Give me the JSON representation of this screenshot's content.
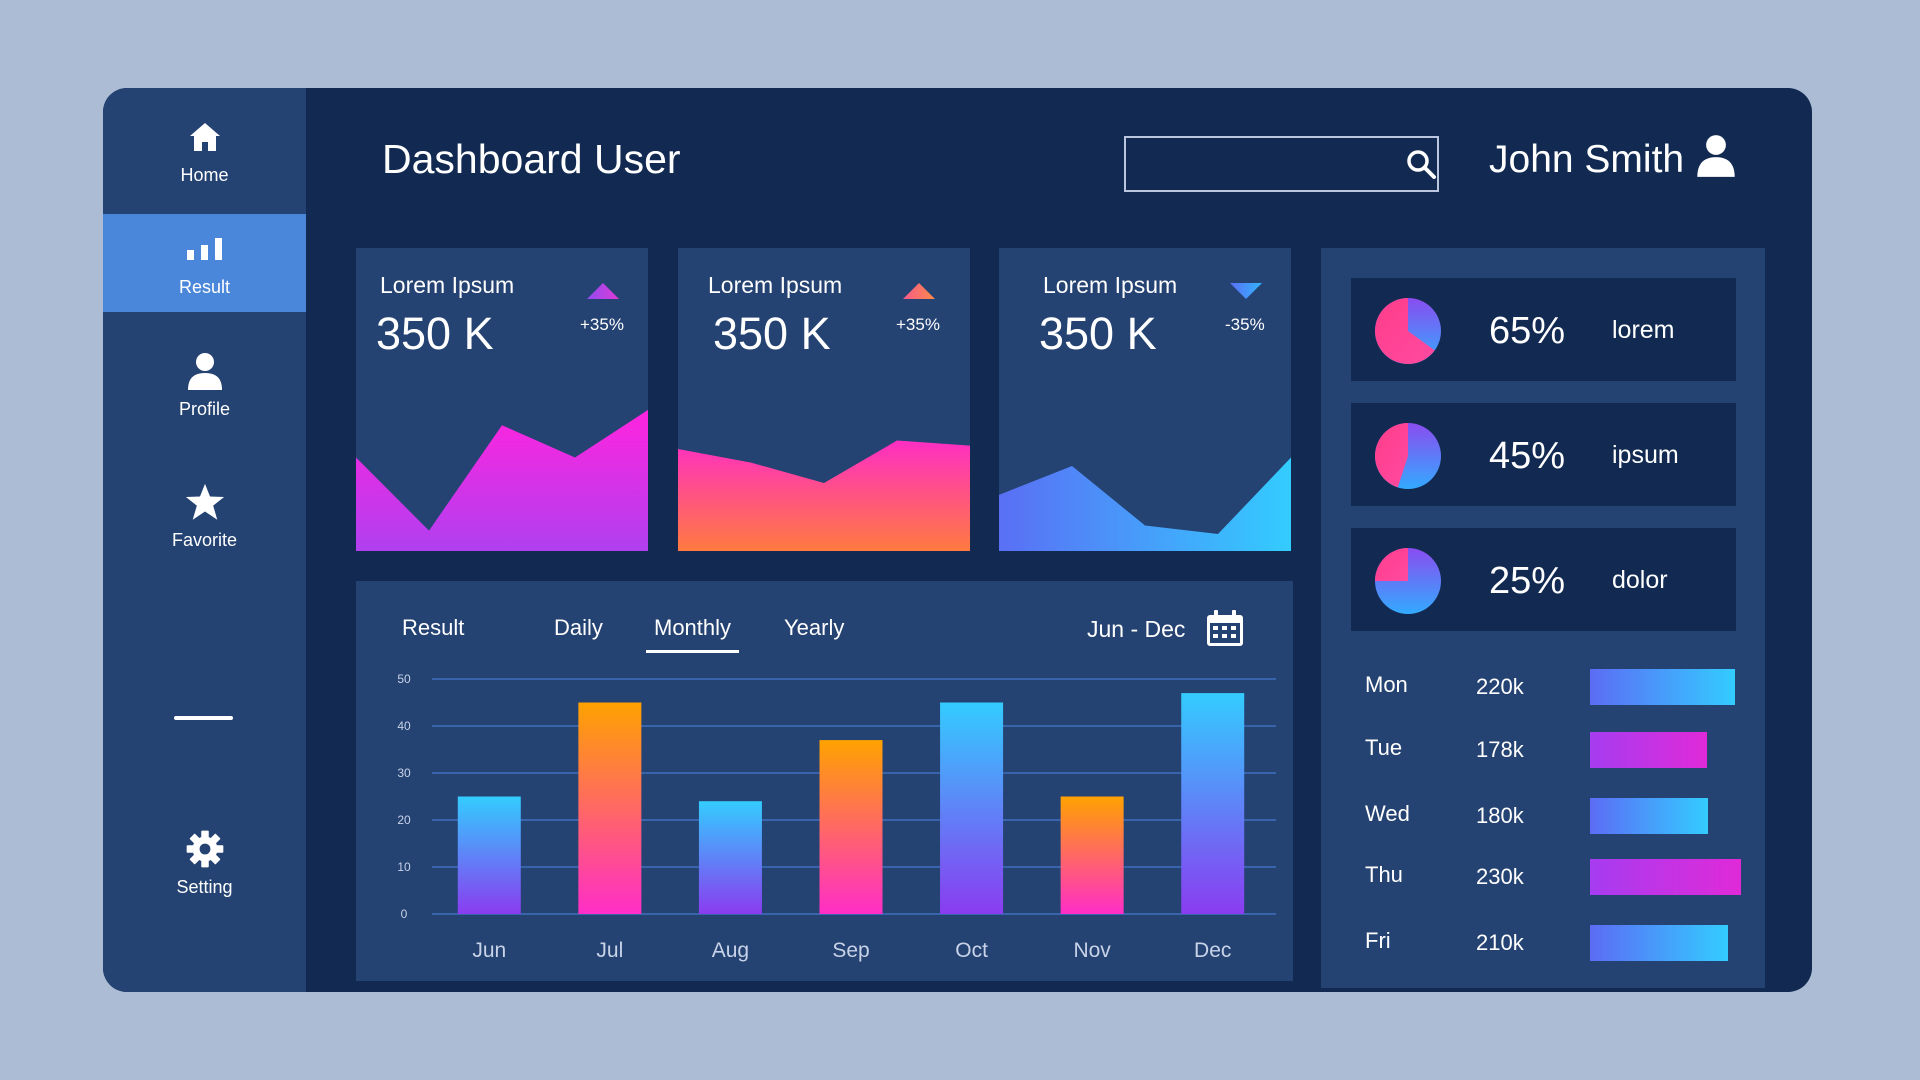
{
  "header": {
    "title": "Dashboard User",
    "search": {
      "value": "",
      "placeholder": ""
    },
    "user_name": "John Smith"
  },
  "sidebar": {
    "items": [
      {
        "label": "Home",
        "icon": "home-icon",
        "active": false
      },
      {
        "label": "Result",
        "icon": "bar-chart-icon",
        "active": true
      },
      {
        "label": "Profile",
        "icon": "user-icon",
        "active": false
      },
      {
        "label": "Favorite",
        "icon": "star-icon",
        "active": false
      },
      {
        "label": "Setting",
        "icon": "gear-icon",
        "active": false
      }
    ]
  },
  "kpis": [
    {
      "label": "Lorem Ipsum",
      "value": "350 K",
      "change": "+35%",
      "direction": "up",
      "arrow_color": "#c03cf0",
      "series": [
        0.55,
        0.12,
        0.74,
        0.55,
        0.83
      ],
      "gradient": [
        "#f02ae0",
        "#b640f0"
      ]
    },
    {
      "label": "Lorem Ipsum",
      "value": "350 K",
      "change": "+35%",
      "direction": "up",
      "arrow_color": "#f4707a",
      "series": [
        0.6,
        0.52,
        0.4,
        0.65,
        0.62
      ],
      "gradient": [
        "#ff3db5",
        "#ff7a47"
      ]
    },
    {
      "label": "Lorem Ipsum",
      "value": "350 K",
      "change": "-35%",
      "direction": "down",
      "arrow_color": "#4a8df0",
      "series": [
        0.33,
        0.5,
        0.15,
        0.1,
        0.55
      ],
      "gradient": [
        "#5a6ff5",
        "#33ccff"
      ]
    }
  ],
  "result_panel": {
    "title": "Result",
    "tabs": [
      "Daily",
      "Monthly",
      "Yearly"
    ],
    "active_tab": "Monthly",
    "range": "Jun - Dec"
  },
  "chart_data": {
    "type": "bar",
    "categories": [
      "Jun",
      "Jul",
      "Aug",
      "Sep",
      "Oct",
      "Nov",
      "Dec"
    ],
    "values": [
      25,
      45,
      24,
      37,
      45,
      25,
      47
    ],
    "bar_styles": [
      "blue",
      "orange",
      "blue",
      "orange",
      "blue",
      "orange",
      "blue"
    ],
    "ylim": [
      0,
      50
    ],
    "yticks": [
      0,
      10,
      20,
      30,
      40,
      50
    ],
    "grid": true,
    "title": "",
    "xlabel": "",
    "ylabel": ""
  },
  "pies": [
    {
      "percent": "65%",
      "label": "lorem",
      "fraction": 0.65
    },
    {
      "percent": "45%",
      "label": "ipsum",
      "fraction": 0.45
    },
    {
      "percent": "25%",
      "label": "dolor",
      "fraction": 0.25
    }
  ],
  "daily_stats": [
    {
      "day": "Mon",
      "value": "220k",
      "amount": 220,
      "style": "blue"
    },
    {
      "day": "Tue",
      "value": "178k",
      "amount": 178,
      "style": "purple"
    },
    {
      "day": "Wed",
      "value": "180k",
      "amount": 180,
      "style": "blue"
    },
    {
      "day": "Thu",
      "value": "230k",
      "amount": 230,
      "style": "purple"
    },
    {
      "day": "Fri",
      "value": "210k",
      "amount": 210,
      "style": "blue"
    }
  ],
  "colors": {
    "background": "#adbcd5",
    "app_bg": "#122a52",
    "panel_bg": "#244272",
    "active_nav": "#4a86d9",
    "grid_line": "#3e6fbf",
    "blue_gradient": [
      "#33ccff",
      "#8a3cf0"
    ],
    "orange_gradient": [
      "#ffa200",
      "#ff2ec8"
    ],
    "purple_gradient": [
      "#a63cf0",
      "#e02ad8"
    ],
    "hbar_blue_gradient": [
      "#5c6cf5",
      "#33ccff"
    ],
    "pie_primary": "#ff3d8a",
    "pie_secondary": "#4a6cf5"
  }
}
